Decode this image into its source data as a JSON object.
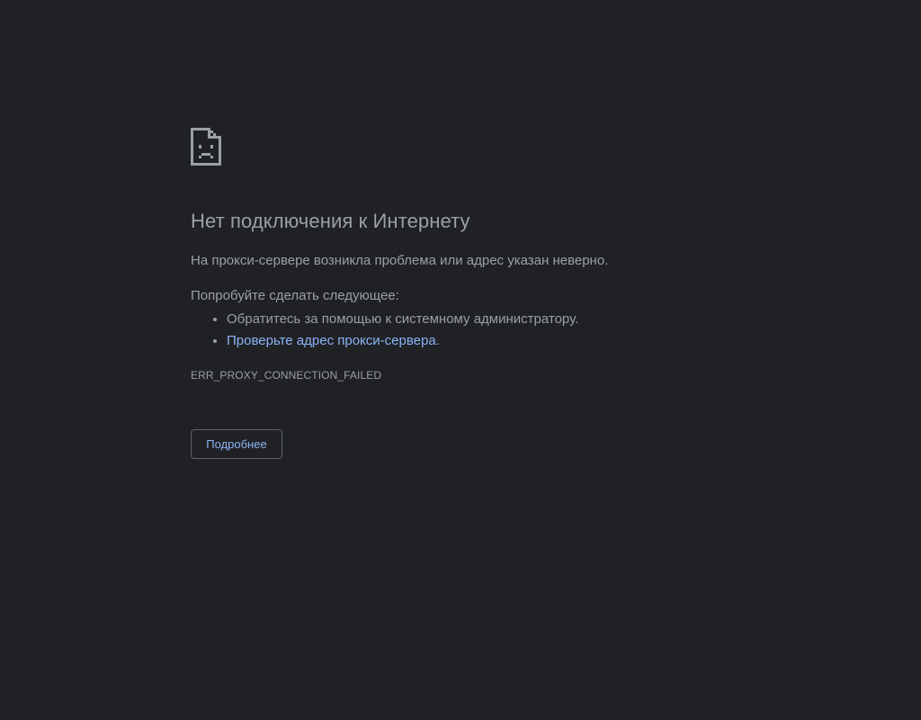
{
  "page": {
    "background": "#202124",
    "text_color": "#9aa0a6",
    "link_color": "#8ab4f8",
    "border_color": "#5f6368"
  },
  "icon": "sad-page-icon",
  "heading": "Нет подключения к Интернету",
  "description": "На прокси-сервере возникла проблема или адрес указан неверно.",
  "suggestions": {
    "title": "Попробуйте сделать следующее:",
    "items": [
      {
        "text": "Обратитесь за помощью к системному администратору."
      },
      {
        "link_text": "Проверьте адрес прокси-сервера",
        "suffix": "."
      }
    ]
  },
  "error_code": "ERR_PROXY_CONNECTION_FAILED",
  "details_button": "Подробнее"
}
